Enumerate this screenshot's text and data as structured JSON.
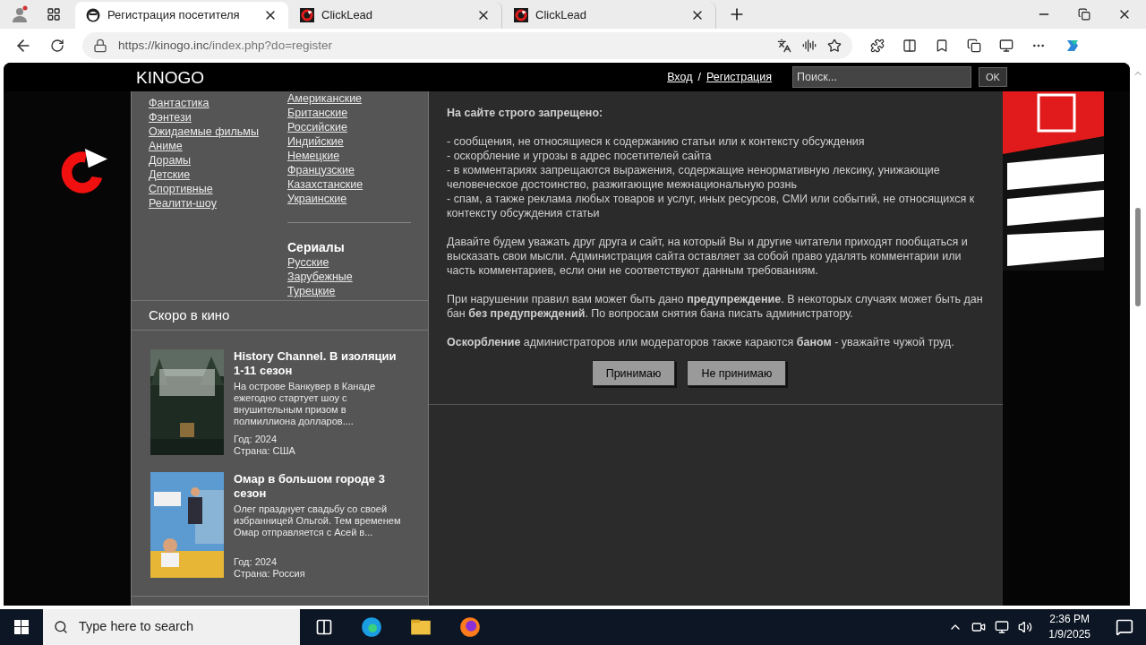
{
  "browser": {
    "tabs": [
      {
        "title": "Регистрация посетителя",
        "selected": true,
        "kind": "site"
      },
      {
        "title": "ClickLead",
        "selected": false,
        "kind": "ad"
      },
      {
        "title": "ClickLead",
        "selected": false,
        "kind": "ad"
      }
    ],
    "url": {
      "host": "https://kinogo.inc",
      "path": "/index.php?do=register"
    }
  },
  "header": {
    "logo": "KINOGO",
    "links": [
      "Вход",
      "Регистрация"
    ],
    "separator": "/",
    "search": {
      "placeholder": "Поиск..."
    },
    "search_button": "OK"
  },
  "sidebar": {
    "genres": [
      "Фантастика",
      "Фэнтези",
      "Ожидаемые фильмы",
      "Аниме",
      "Дорамы",
      "Детские",
      "Спортивные",
      "Реалити-шоу"
    ],
    "countries": [
      "Американские",
      "Британские",
      "Российские",
      "Индийские",
      "Немецкие",
      "Французские",
      "Казахстанские",
      "Украинские"
    ],
    "series_heading": "Сериалы",
    "series": [
      "Русские",
      "Зарубежные",
      "Турецкие"
    ],
    "upcoming": {
      "heading": "Скоро в кино",
      "movies": [
        {
          "title": "History Channel. В изоляции 1-11 сезон",
          "description": "На острове Ванкувер в Канаде ежегодно стартует шоу с внушительным призом в полмиллиона долларов....",
          "year": "Год: 2024",
          "country": "Страна: США",
          "kind": "forest"
        },
        {
          "title": "Омар в большом городе 3 сезон",
          "description": "Олег празднует свадьбу со своей избранницей Ольгой. Тем временем Омар отправляется с Асей в...",
          "year": "Год: 2024",
          "country": "Страна: Россия",
          "kind": "city"
        }
      ]
    }
  },
  "rules": {
    "heading": "На сайте строго запрещено:",
    "items": [
      "- сообщения, не относящиеся к содержанию статьи или к контексту обсуждения",
      "- оскорбление и угрозы в адрес посетителей сайта",
      "- в комментариях запрещаются выражения, содержащие ненормативную лексику, унижающие человеческое достоинство, разжигающие межнациональную рознь",
      "- спам, а также реклама любых товаров и услуг, иных ресурсов, СМИ или событий, не относящихся к контексту обсуждения статьи"
    ],
    "paragraphs": [
      "Давайте будем уважать друг друга и сайт, на который Вы и другие читатели приходят пообщаться и высказать свои мысли. Администрация сайта оставляет за собой право удалять комментарии или часть комментариев, если они не соответствуют данным требованиям.",
      "При нарушении правил вам может быть дано **предупреждение**. В некоторых случаях может быть дан бан **без предупреждений**. По вопросам снятия бана писать администратору.",
      "**Оскорбление** администраторов или модераторов также караются **баном** - уважайте чужой труд."
    ],
    "buttons": [
      "Принимаю",
      "Не принимаю"
    ]
  },
  "taskbar": {
    "search": {
      "placeholder": "Type here to search"
    },
    "time": "2:36 PM",
    "date": "1/9/2025"
  }
}
